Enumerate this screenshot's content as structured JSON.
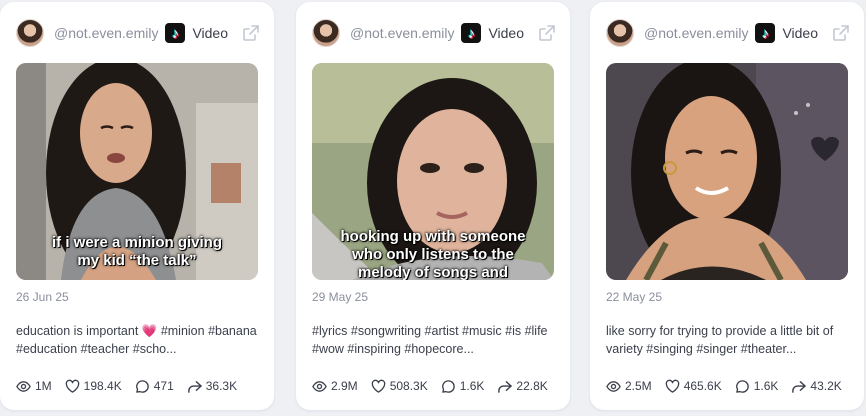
{
  "cards": [
    {
      "handle": "@not.even.emily",
      "platform_icon": "tiktok-icon",
      "type_label": "Video",
      "caption_lines": [
        "hooking up with someone",
        "who only listens to the",
        "melody of songs and"
      ],
      "date": "29 May 25",
      "description": "#lyrics #songwriting #artist #music #is #life #wow #inspiring #hopecore...",
      "stats": {
        "views": "2.9M",
        "likes": "508.3K",
        "comments": "1.6K",
        "shares": "22.8K"
      }
    },
    {
      "handle": "@not.even.emily",
      "platform_icon": "tiktok-icon",
      "type_label": "Video",
      "caption_lines": [],
      "date": "22 May 25",
      "description": "like sorry for trying to provide a little bit of variety #singing #singer #theater...",
      "stats": {
        "views": "2.5M",
        "likes": "465.6K",
        "comments": "1.6K",
        "shares": "43.2K"
      }
    },
    {
      "handle": "@not.even.emily",
      "platform_icon": "tiktok-icon",
      "type_label": "Video",
      "caption_lines": [
        "if i were a minion giving",
        "my kid “the talk”"
      ],
      "date": "26 Jun 25",
      "description_before_emoji": "education is important ",
      "emoji": "💗",
      "description_after_emoji": " #minion #banana #education #teacher #scho...",
      "stats": {
        "views": "1M",
        "likes": "198.4K",
        "comments": "471",
        "shares": "36.3K"
      }
    }
  ],
  "icons": {
    "views": "eye-icon",
    "likes": "heart-icon",
    "comments": "comment-icon",
    "shares": "share-icon",
    "open": "external-link-icon"
  },
  "colors": {
    "muted_text": "#8a8f9c",
    "body_text": "#3a3f4b",
    "emoji_pink": "#e83e8c"
  }
}
